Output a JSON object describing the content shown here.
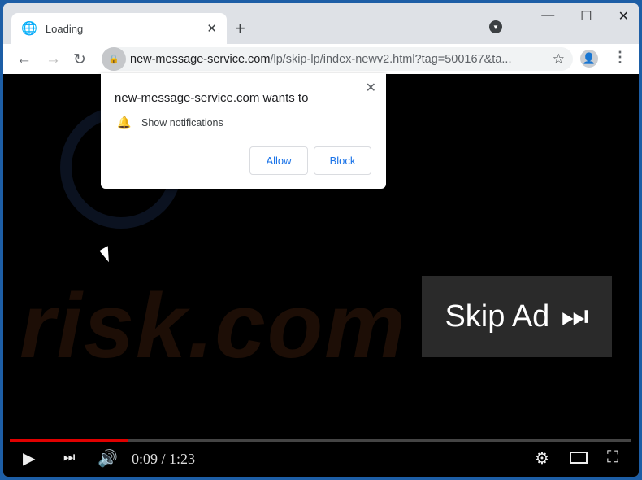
{
  "tab": {
    "title": "Loading",
    "icon": "globe-icon"
  },
  "address_bar": {
    "domain": "new-message-service.com",
    "path": "/lp/skip-lp/index-newv2.html?tag=500167&ta..."
  },
  "popup": {
    "title": "new-message-service.com wants to",
    "message": "Show notifications",
    "allow_label": "Allow",
    "block_label": "Block"
  },
  "video": {
    "skip_label": "Skip Ad",
    "time": "0:09 / 1:23",
    "progress": 0.19,
    "progress_color": "#e00000"
  },
  "watermark": "risk.com"
}
